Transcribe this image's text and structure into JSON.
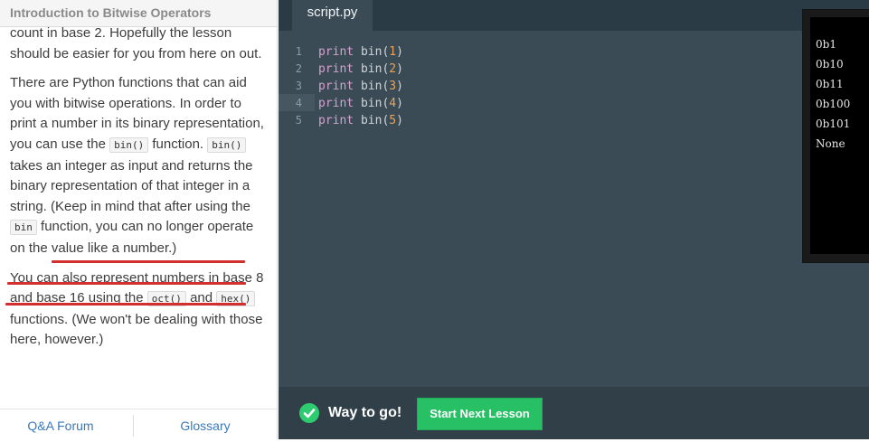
{
  "lesson": {
    "title": "Introduction to Bitwise Operators",
    "p1": "count in base 2. Hopefully the lesson should be easier for you from here on out.",
    "p2_pre": "There are Python functions that can aid you with bitwise operations. In order to print a number in its binary representation, you can use the ",
    "p2_code1": "bin()",
    "p2_mid": " function. ",
    "p2_code2": "bin()",
    "p2_mid2": " takes an integer as input and returns the binary representation of that integer in a string. (Keep in mind that after using the ",
    "p2_code3": "bin",
    "p2_post": " function, you can no longer operate on the value like a number.)",
    "p3_pre": "You can also represent numbers in base 8 and base 16 using the ",
    "p3_code1": "oct()",
    "p3_mid": " and ",
    "p3_code2": "hex()",
    "p3_post": " functions. (We won't be dealing with those here, however.)"
  },
  "footer_links": {
    "qa": "Q&A Forum",
    "glossary": "Glossary"
  },
  "editor": {
    "tab": "script.py",
    "line_numbers": [
      "1",
      "2",
      "3",
      "4",
      "5"
    ],
    "lines": [
      {
        "kw": "print",
        "fn": " bin(",
        "arg": "1",
        "close": ")"
      },
      {
        "kw": "print",
        "fn": " bin(",
        "arg": "2",
        "close": ")"
      },
      {
        "kw": "print",
        "fn": " bin(",
        "arg": "3",
        "close": ")"
      },
      {
        "kw": "print",
        "fn": " bin(",
        "arg": "4",
        "close": ")"
      },
      {
        "kw": "print",
        "fn": " bin(",
        "arg": "5",
        "close": ")"
      }
    ]
  },
  "output": [
    "0b1",
    "0b10",
    "0b11",
    "0b100",
    "0b101",
    "None"
  ],
  "success": {
    "message": "Way to go!",
    "button": "Start Next Lesson"
  },
  "colors": {
    "accent_green": "#27c065",
    "underline_red": "#d32f2f",
    "link_blue": "#3b79b8"
  }
}
